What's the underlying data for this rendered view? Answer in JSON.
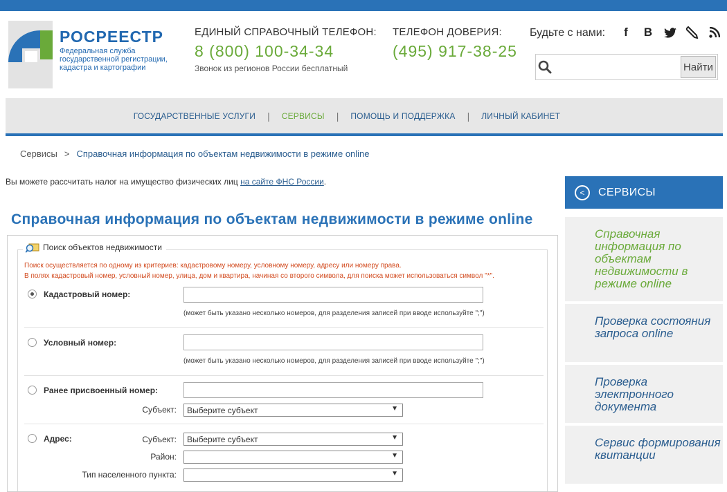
{
  "logo": {
    "title": "РОСРЕЕСТР",
    "subtitle_lines": [
      "Федеральная служба",
      "государственной регистрации,",
      "кадастра и картографии"
    ]
  },
  "phones": [
    {
      "label": "ЕДИНЫЙ СПРАВОЧНЫЙ ТЕЛЕФОН:",
      "number": "8 (800) 100-34-34",
      "note": "Звонок из регионов России бесплатный"
    },
    {
      "label": "ТЕЛЕФОН ДОВЕРИЯ:",
      "number": "(495) 917-38-25"
    }
  ],
  "social": {
    "label": "Будьте с нами:",
    "icons": [
      "facebook-icon",
      "vk-icon",
      "twitter-icon",
      "livejournal-icon",
      "rss-icon"
    ]
  },
  "search": {
    "placeholder": "",
    "button": "Найти"
  },
  "nav": {
    "items": [
      {
        "label": "ГОСУДАРСТВЕННЫЕ УСЛУГИ",
        "active": false
      },
      {
        "label": "СЕРВИСЫ",
        "active": true
      },
      {
        "label": "ПОМОЩЬ И ПОДДЕРЖКА",
        "active": false
      },
      {
        "label": "ЛИЧНЫЙ КАБИНЕТ",
        "active": false
      }
    ]
  },
  "breadcrumb": {
    "root": "Сервисы",
    "arrow": ">",
    "current": "Справочная информация по объектам недвижимости в режиме online"
  },
  "tax_note": {
    "text": "Вы можете рассчитать налог на имущество физических лиц ",
    "link": "на сайте ФНС России",
    "end": "."
  },
  "page_title": "Справочная информация по объектам недвижимости в режиме online",
  "form": {
    "legend": "Поиск объектов недвижимости",
    "notes": [
      "Поиск осуществляется по одному из критериев: кадастровому номеру, условному номеру, адресу или номеру права.",
      "В полях кадастровый номер, условный номер, улица, дом и квартира, начиная со второго символа, для поиска может использоваться символ \"*\"."
    ],
    "cadastral": {
      "label": "Кадастровый номер:",
      "value": "",
      "hint": "(может быть указано несколько номеров, для разделения записей при вводе используйте \";\")",
      "checked": true
    },
    "conditional": {
      "label": "Условный номер:",
      "value": "",
      "hint": "(может быть указано несколько номеров, для разделения записей при вводе используйте \";\")",
      "checked": false
    },
    "previous": {
      "label": "Ранее присвоенный номер:",
      "value": "",
      "subject_label": "Субъект:",
      "subject_value": "Выберите субъект",
      "checked": false
    },
    "address": {
      "label": "Адрес:",
      "checked": false,
      "subject_label": "Субъект:",
      "subject_value": "Выберите субъект",
      "district_label": "Район:",
      "district_value": "",
      "settlement_type_label": "Тип населенного пункта:",
      "settlement_type_value": ""
    }
  },
  "sidebar": {
    "title": "СЕРВИСЫ",
    "items": [
      {
        "label": "Справочная информация по объектам недвижимости в режиме online",
        "active": true
      },
      {
        "label": "Проверка состояния запроса online",
        "active": false
      },
      {
        "label": "Проверка электронного документа",
        "active": false
      },
      {
        "label": "Сервис формирования квитанции",
        "active": false
      }
    ]
  },
  "colors": {
    "brand_blue": "#2a72b7",
    "accent_green": "#6aaa3a",
    "note_red": "#d24a1e"
  }
}
